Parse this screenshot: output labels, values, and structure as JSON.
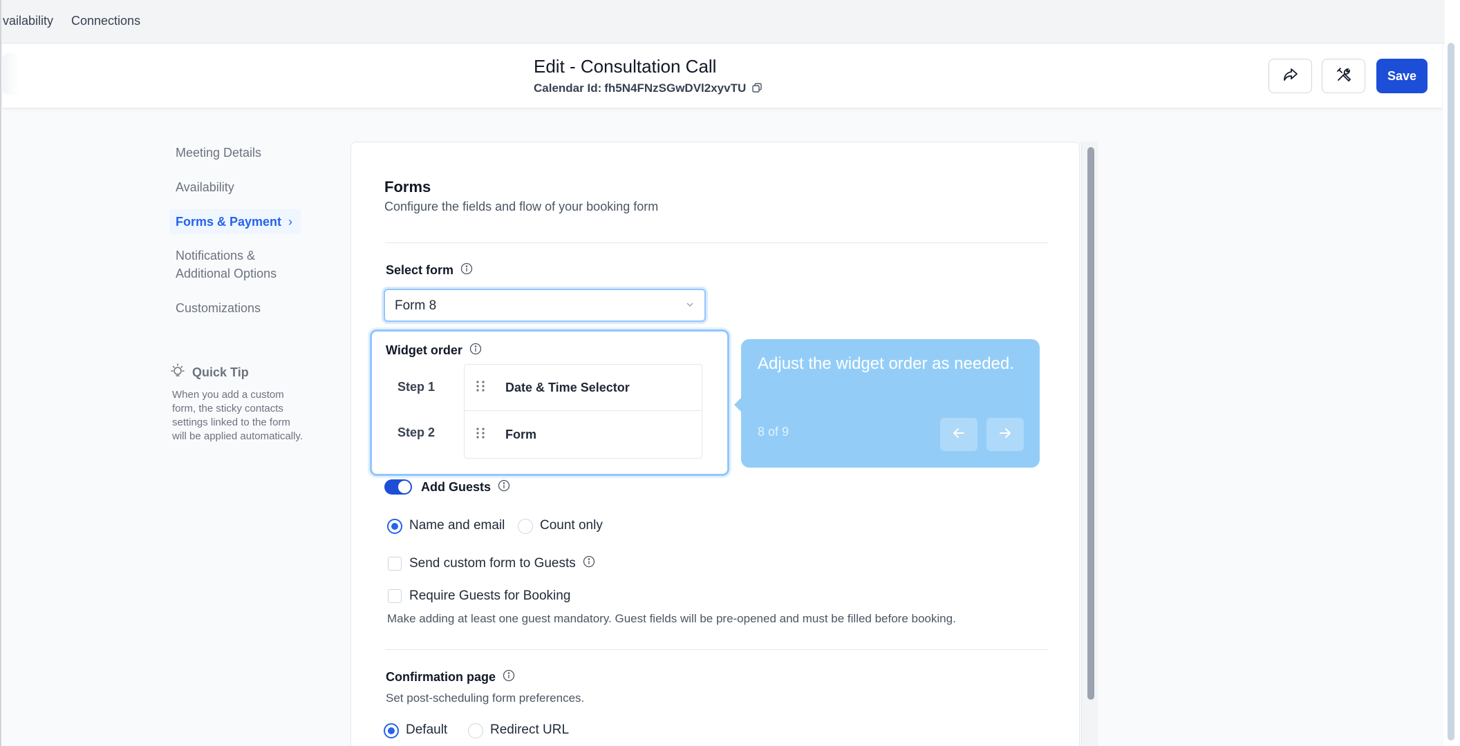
{
  "topnav": {
    "items": [
      "vailability",
      "Connections"
    ]
  },
  "header": {
    "title": "Edit - Consultation Call",
    "calendar_id_label": "Calendar Id:",
    "calendar_id": "fh5N4FNzSGwDVl2xyvTU",
    "icons": [
      "share-icon",
      "tools-icon",
      "copy-icon"
    ],
    "save_label": "Save"
  },
  "sidebar": {
    "items": [
      {
        "label": "Meeting Details",
        "active": false
      },
      {
        "label": "Availability",
        "active": false
      },
      {
        "label": "Forms & Payment",
        "active": true
      },
      {
        "label": "Notifications & Additional Options",
        "active": false
      },
      {
        "label": "Customizations",
        "active": false
      }
    ],
    "tip_title": "Quick Tip",
    "tip_body": "When you add a custom form, the sticky contacts settings linked to the form will be applied automatically."
  },
  "forms": {
    "title": "Forms",
    "subtitle": "Configure the fields and flow of your booking form",
    "select_form_label": "Select form",
    "selected_form": "Form 8",
    "widget_order_label": "Widget order",
    "steps": [
      {
        "step": "Step 1",
        "name": "Date & Time Selector"
      },
      {
        "step": "Step 2",
        "name": "Form"
      }
    ],
    "add_guests_label": "Add Guests",
    "add_guests_enabled": true,
    "guest_mode_options": [
      "Name and email",
      "Count only"
    ],
    "guest_mode_selected": "Name and email",
    "send_custom_form_label": "Send custom form to Guests",
    "require_guests_label": "Require Guests for Booking",
    "require_guests_help": "Make adding at least one guest mandatory. Guest fields will be pre-opened and must be filled before booking.",
    "confirmation_label": "Confirmation page",
    "confirmation_help": "Set post-scheduling form preferences.",
    "confirmation_options": [
      "Default",
      "Redirect URL"
    ],
    "confirmation_selected": "Default"
  },
  "tour": {
    "message": "Adjust the widget order as needed.",
    "counter": "8 of 9"
  },
  "colors": {
    "accent": "#1d4ed8",
    "tooltip_bg": "#93cdf7",
    "active_nav": "#2563eb"
  }
}
